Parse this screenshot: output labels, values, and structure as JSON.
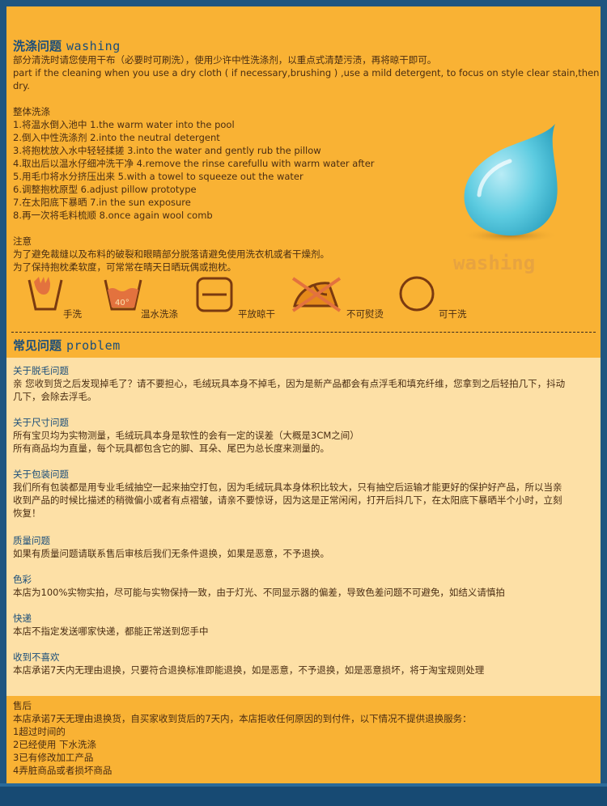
{
  "washing": {
    "title_cn": "洗涤问题",
    "title_en": "washing",
    "intro_cn": "部分清洗时请您使用干布（必要时可刷洗），使用少许中性洗涤剂，以重点式清楚污渍，再将晾干即可。",
    "intro_en_1": "part if the cleaning when you use a dry cloth ( if necessary,brushing ) ,use a mild detergent, to focus on style clear stain,then",
    "intro_en_2": "dry.",
    "overall_title": "整体洗涤",
    "steps": [
      "1.将温水倒入池中   1.the warm water into the pool",
      "2.倒入中性洗涤剂   2.into the neutral detergent",
      "3.将抱枕放入水中轻轻揉搓   3.into the water and gently rub the pillow",
      "4.取出后以温水仔细冲洗干净   4.remove the rinse carefullu with warm water after",
      "5.用毛巾将水分挤压出来   5.with a towel to squeeze out the water",
      "6.调整抱枕原型   6.adjust pillow prototype",
      "7.在太阳底下暴晒   7.in the sun exposure",
      "8.再一次将毛料梳顺   8.once again wool comb"
    ],
    "note_title": "注意",
    "note_1": "为了避免裁缝以及布料的破裂和眼睛部分脱落请避免使用洗衣机或者干燥剂。",
    "note_2": "为了保持抱枕柔软度，可常常在晴天日晒玩偶或抱枕。",
    "logo_text": "washing",
    "icons": [
      {
        "label": "手洗",
        "icon": "hand-wash-icon"
      },
      {
        "label": "温水洗涤",
        "icon": "warm-wash-40-icon",
        "temp": "40°"
      },
      {
        "label": "平放晾干",
        "icon": "dry-flat-icon"
      },
      {
        "label": "不可熨烫",
        "icon": "no-iron-icon"
      },
      {
        "label": "可干洗",
        "icon": "dry-clean-icon"
      }
    ]
  },
  "problem": {
    "title_cn": "常见问题",
    "title_en": "problem",
    "items": [
      {
        "q": "关于脱毛问题",
        "a": [
          "亲 您收到货之后发现掉毛了？请不要担心，毛绒玩具本身不掉毛，因为是新产品都会有点浮毛和填充纤维，您拿到之后轻拍几下，抖动",
          "几下，会除去浮毛。"
        ]
      },
      {
        "q": "关于尺寸问题",
        "a": [
          "所有宝贝均为实物测量，毛绒玩具本身是软性的会有一定的误差（大概是3CM之间）",
          "所有商品均为直量，每个玩具都包含它的脚、耳朵、尾巴为总长度来测量的。"
        ]
      },
      {
        "q": "关于包装问题",
        "a": [
          "我们所有包装都是用专业毛绒抽空一起来抽空打包，因为毛绒玩具本身体积比较大，只有抽空后运输才能更好的保护好产品，所以当亲",
          "收到产品的时候比描述的稍微偏小或者有点褶皱，请亲不要惊讶，因为这是正常闲闲，打开后抖几下，在太阳底下暴晒半个小时，立刻",
          "恢复！"
        ]
      },
      {
        "q": "质量问题",
        "a": [
          "如果有质量问题请联系售后审核后我们无条件退换，如果是恶意，不予退换。"
        ]
      },
      {
        "q": "色彩",
        "a": [
          "本店为100%实物实拍，尽可能与实物保持一致，由于灯光、不同显示器的偏差，导致色差问题不可避免，如结义请慎拍"
        ]
      },
      {
        "q": "快递",
        "a": [
          "本店不指定发送哪家快递，都能正常送到您手中"
        ]
      },
      {
        "q": "收到不喜欢",
        "a": [
          "本店承诺7天内无理由退换，只要符合退换标准即能退换，如是恶意，不予退换，如是恶意损坏，将于淘宝规则处理"
        ]
      }
    ]
  },
  "aftersale": {
    "title": "售后",
    "lines": [
      "本店承诺7天无理由退换货，自买家收到货后的7天内，本店拒收任何原因的到付件，以下情况不提供退换服务：",
      "1超过时间的",
      "2已经使用 下水洗涤",
      "3已有修改加工产品",
      "4弄脏商品或者损坏商品"
    ]
  },
  "colors": {
    "frame": "#1f5580",
    "orange_panel": "#f9b234",
    "cream_panel": "#fde0a6",
    "title_blue": "#1b4e7a",
    "text_brown": "#4a2d12",
    "icon_brown": "#7a3a10",
    "drop": "#4fc1d9"
  }
}
